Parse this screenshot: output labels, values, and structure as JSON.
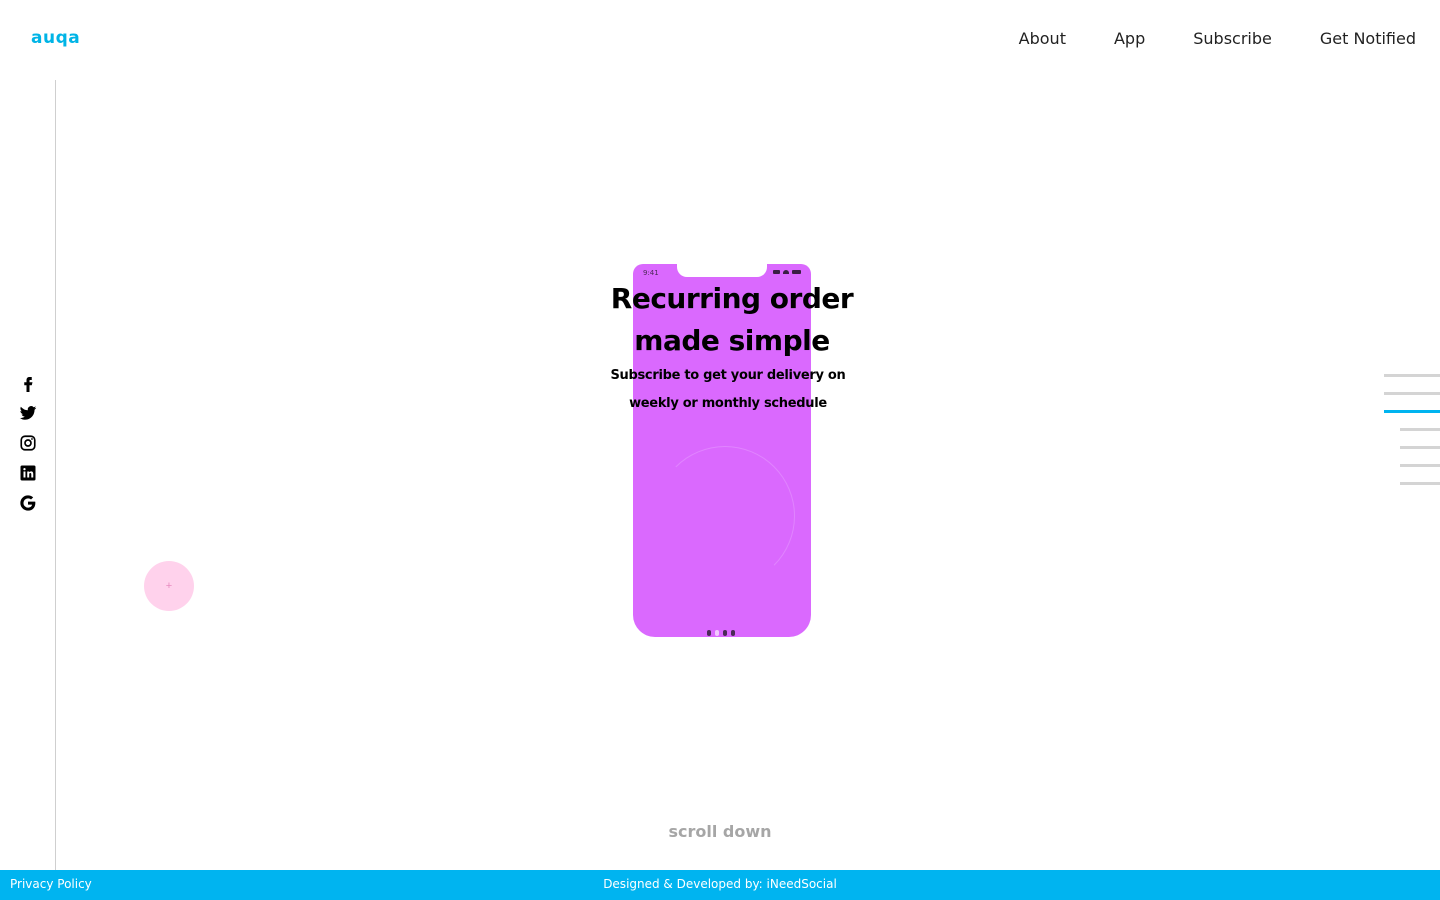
{
  "brand": {
    "logo_text": "auqa",
    "accent": "#00b4f0"
  },
  "nav": {
    "items": [
      "About",
      "App",
      "Subscribe",
      "Get Notified"
    ]
  },
  "social": [
    "facebook-icon",
    "twitter-icon",
    "instagram-icon",
    "linkedin-icon",
    "google-icon"
  ],
  "hero": {
    "title_line1": "Recurring order",
    "title_line2": "made simple",
    "subtitle_line1": "Subscribe to get your delivery on",
    "subtitle_line2": "weekly or monthly schedule"
  },
  "phone": {
    "status_time": "9:41",
    "screen_color": "#da69fe"
  },
  "cursor": {
    "glyph": "+"
  },
  "scroll": {
    "label": "scroll down"
  },
  "section_indicator": {
    "count": 6,
    "active_index": 2
  },
  "footer": {
    "privacy_label": "Privacy Policy",
    "credit": "Designed & Developed by: iNeedSocial"
  }
}
